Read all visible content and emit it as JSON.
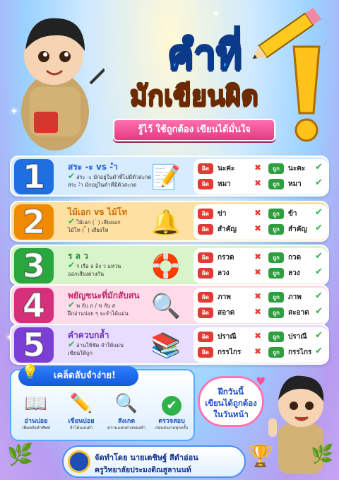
{
  "header": {
    "title_line1": "คำที่",
    "title_line2": "มักเขียนผิด",
    "subtitle": "รู้ไว้ ใช้ถูกต้อง เขียนได้มั่นใจ"
  },
  "labels": {
    "wrong": "ผิด",
    "correct": "ถูก"
  },
  "rows": [
    {
      "num": "1",
      "title": "สระ -ะ vs -ำ",
      "desc1": "สระ -ะ มักอยู่ในคำที่ไม่มีตัวสะกด",
      "desc2": "สระ -ำ มักอยู่ในคำที่มีตัวสะกด",
      "pairs": [
        {
          "wrong": "นะค่ะ",
          "correct": "นะคะ"
        },
        {
          "wrong": "หมา",
          "correct": "หมา"
        }
      ]
    },
    {
      "num": "2",
      "title": "ไม้เอก vs ไม้โท",
      "desc1": "ไม้เอก ( ่ ) เสียงเอก",
      "desc2": "ไม้โท ( ้ ) เสียงโท",
      "pairs": [
        {
          "wrong": "ข่า",
          "correct": "ข้า"
        },
        {
          "wrong": "สำคัญ",
          "correct": "สำคัญ"
        }
      ]
    },
    {
      "num": "3",
      "title": "ร ล ว",
      "desc1": "ร เรือ ล ลิง ว แหวน",
      "desc2": "ออกเสียงต่างกัน",
      "pairs": [
        {
          "wrong": "กรวด",
          "correct": "กวด"
        },
        {
          "wrong": "ลวง",
          "correct": "ลวง"
        }
      ]
    },
    {
      "num": "4",
      "title": "พยัญชนะที่มักสับสน",
      "desc1": "พ กับ ภ / ข กับ ส",
      "desc2": "ฝึกอ่านบ่อย ๆ จะจำได้แม่น",
      "pairs": [
        {
          "wrong": "ภาพ",
          "correct": "ภาพ"
        },
        {
          "wrong": "สอาด",
          "correct": "สะอาด"
        }
      ]
    },
    {
      "num": "5",
      "title": "คำควบกล้ำ",
      "desc1": "อ่านให้ชัด จำให้แม่น",
      "desc2": "เขียนให้ถูก",
      "pairs": [
        {
          "wrong": "ปราณี",
          "correct": "ปราณี"
        },
        {
          "wrong": "กรรไกร",
          "correct": "กรรไกร"
        }
      ]
    }
  ],
  "tips": {
    "title": "เคล็ดลับจำง่าย!",
    "items": [
      {
        "label": "อ่านบ่อย",
        "desc": "เพิ่มคลังคำศัพท์",
        "icon": "book-icon"
      },
      {
        "label": "เขียนบ่อย",
        "desc": "จำได้แม่นยำ",
        "icon": "pencil-icon"
      },
      {
        "label": "สังเกต",
        "desc": "ความแตกต่างของคำ",
        "icon": "magnifier-icon"
      },
      {
        "label": "ตรวจสอบ",
        "desc": "ก่อนส่งงานทุกครั้ง",
        "icon": "check-icon"
      }
    ]
  },
  "bubble": {
    "line1": "ฝึกวันนี้",
    "line2": "เขียนได้ถูกต้อง",
    "line3": "ในวันหน้า"
  },
  "footer": {
    "line1": "จัดทำโดย นายเตชิษฐ์ สีดำอ่อน",
    "line2": "ครูวิทยาลัยประมงติณสูลานนท์"
  },
  "colors": {
    "row1": "#d8ecff",
    "row2": "#ffe0a3",
    "row3": "#d8f5c9",
    "row4": "#ffdbe9",
    "row5": "#e8dcff"
  }
}
